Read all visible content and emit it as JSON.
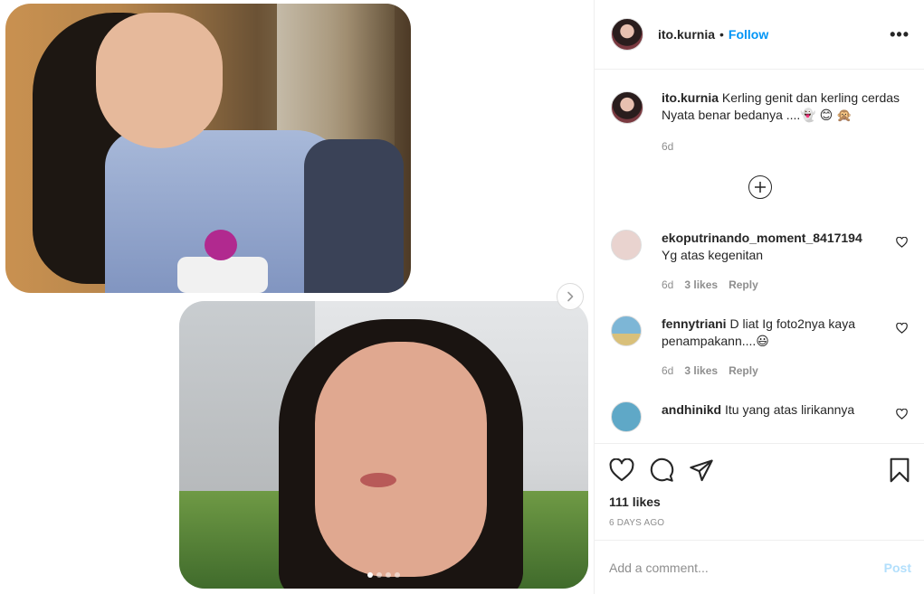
{
  "post": {
    "username": "ito.kurnia",
    "separator": "•",
    "follow_label": "Follow",
    "more_label": "•••",
    "caption_line1": "Kerling genit dan kerling cerdas",
    "caption_line2": "Nyata benar bedanya ....👻 😊 🙊",
    "caption_age": "6d",
    "likes": "111 likes",
    "date": "6 DAYS AGO"
  },
  "carousel": {
    "total": 4,
    "active_index": 0
  },
  "comments": [
    {
      "username": "ekoputrinando_moment_8417194",
      "text": "Yg atas kegenitan",
      "age": "6d",
      "likes": "3 likes",
      "reply": "Reply",
      "avatar_color": "#e9d3cf"
    },
    {
      "username": "fennytriani",
      "text": "D liat Ig foto2nya kaya penampakann....😃",
      "age": "6d",
      "likes": "3 likes",
      "reply": "Reply",
      "avatar_color": "#7db6d6"
    },
    {
      "username": "andhinikd",
      "text": "Itu yang atas lirikannya",
      "age": "",
      "likes": "",
      "reply": "",
      "avatar_color": "#5fa8c7"
    }
  ],
  "add_comment": {
    "placeholder": "Add a comment...",
    "post_label": "Post"
  },
  "colors": {
    "follow": "#0095f6",
    "post_disabled": "#b2dffc",
    "meta": "#8e8e8e"
  },
  "icons": [
    "like-icon",
    "comment-icon",
    "share-icon",
    "bookmark-icon",
    "chevron-right-icon",
    "more-icon",
    "plus-circle-icon",
    "heart-small-icon"
  ]
}
